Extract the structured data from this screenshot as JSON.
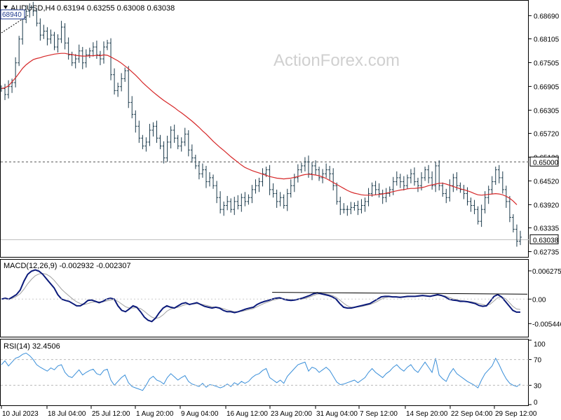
{
  "header": {
    "symbol": "AUDUSD,H4",
    "ohlc": "0.63194 0.63255 0.63008 0.63038"
  },
  "watermark": "ActionForex.com",
  "colors": {
    "price": "#1b3a4b",
    "ma": "#d62728",
    "macd": "#0b1a7a",
    "signal": "#a0a0a0",
    "rsi": "#3a8fd9",
    "hline": "#555555"
  },
  "chart_data": [
    {
      "type": "line",
      "title": "AUDUSD,H4",
      "x_ticks": [
        "10 Jul 2023",
        "18 Jul 04:00",
        "25 Jul 12:00",
        "1 Aug 20:00",
        "9 Aug 04:00",
        "16 Aug 12:00",
        "23 Aug 20:00",
        "31 Aug 04:00",
        "7 Sep 12:00",
        "14 Sep 20:00",
        "22 Sep 04:00",
        "29 Sep 12:00"
      ],
      "y_ticks": [
        "0.68690",
        "0.68105",
        "0.67505",
        "0.66905",
        "0.66305",
        "0.65720",
        "0.65120",
        "0.64520",
        "0.63920",
        "0.63335",
        "0.62735"
      ],
      "ylim": [
        0.6262,
        0.6905
      ],
      "labels": {
        "start_level": "68940",
        "level": "0.65000",
        "last": "0.63038"
      },
      "series": [
        {
          "values": [
            0.6685,
            0.667,
            0.669,
            0.67,
            0.675,
            0.681,
            0.686,
            0.688,
            0.689,
            0.688,
            0.685,
            0.682,
            0.683,
            0.681,
            0.682,
            0.679,
            0.681,
            0.684,
            0.68,
            0.677,
            0.675,
            0.676,
            0.678,
            0.675,
            0.677,
            0.678,
            0.679,
            0.677,
            0.676,
            0.679,
            0.68,
            0.672,
            0.668,
            0.669,
            0.671,
            0.673,
            0.665,
            0.662,
            0.659,
            0.656,
            0.654,
            0.655,
            0.658,
            0.659,
            0.656,
            0.654,
            0.651,
            0.655,
            0.658,
            0.656,
            0.654,
            0.655,
            0.657,
            0.653,
            0.651,
            0.649,
            0.647,
            0.648,
            0.645,
            0.646,
            0.644,
            0.641,
            0.638,
            0.639,
            0.64,
            0.638,
            0.64,
            0.639,
            0.641,
            0.64,
            0.641,
            0.643,
            0.644,
            0.645,
            0.647,
            0.648,
            0.643,
            0.642,
            0.64,
            0.641,
            0.639,
            0.642,
            0.644,
            0.646,
            0.648,
            0.649,
            0.65,
            0.647,
            0.649,
            0.648,
            0.646,
            0.647,
            0.648,
            0.647,
            0.644,
            0.64,
            0.638,
            0.638,
            0.638,
            0.6385,
            0.639,
            0.638,
            0.639,
            0.64,
            0.642,
            0.644,
            0.643,
            0.642,
            0.641,
            0.642,
            0.643,
            0.645,
            0.646,
            0.645,
            0.644,
            0.646,
            0.647,
            0.645,
            0.644,
            0.646,
            0.648,
            0.646,
            0.644,
            0.649,
            0.644,
            0.642,
            0.641,
            0.644,
            0.646,
            0.644,
            0.643,
            0.642,
            0.64,
            0.639,
            0.638,
            0.635,
            0.638,
            0.641,
            0.643,
            0.645,
            0.648,
            0.646,
            0.643,
            0.64,
            0.636,
            0.633,
            0.63,
            0.631
          ]
        },
        {
          "values": [
            0.6685,
            0.6687,
            0.6692,
            0.6702,
            0.6712,
            0.6724,
            0.6736,
            0.6745,
            0.6752,
            0.6758,
            0.6761,
            0.6763,
            0.6766,
            0.6768,
            0.677,
            0.6772,
            0.6773,
            0.6774,
            0.6774,
            0.6772,
            0.6771,
            0.6769,
            0.6768,
            0.6767,
            0.6767,
            0.6768,
            0.6768,
            0.6769,
            0.6768,
            0.677,
            0.6769,
            0.6765,
            0.676,
            0.6755,
            0.6749,
            0.6742,
            0.6735,
            0.6727,
            0.6719,
            0.671,
            0.67,
            0.6692,
            0.6684,
            0.6676,
            0.6669,
            0.6662,
            0.6655,
            0.6649,
            0.6643,
            0.6637,
            0.663,
            0.6624,
            0.6617,
            0.661,
            0.6603,
            0.6595,
            0.6587,
            0.6578,
            0.657,
            0.6561,
            0.6552,
            0.6544,
            0.6536,
            0.6529,
            0.6521,
            0.6513,
            0.6506,
            0.6499,
            0.6492,
            0.6486,
            0.6482,
            0.6478,
            0.6475,
            0.6472,
            0.6469,
            0.6466,
            0.6463,
            0.6461,
            0.6459,
            0.6458,
            0.6457,
            0.6458,
            0.6459,
            0.6461,
            0.6463,
            0.6466,
            0.6468,
            0.6469,
            0.6468,
            0.6467,
            0.6465,
            0.6462,
            0.6458,
            0.6453,
            0.6448,
            0.6443,
            0.6438,
            0.6433,
            0.6428,
            0.6424,
            0.6421,
            0.6419,
            0.6417,
            0.6416,
            0.6416,
            0.6416,
            0.6417,
            0.6418,
            0.6419,
            0.6421,
            0.6423,
            0.6425,
            0.6427,
            0.6429,
            0.643,
            0.6432,
            0.6433,
            0.6433,
            0.6434,
            0.6435,
            0.6437,
            0.644,
            0.6442,
            0.6444,
            0.6446,
            0.6446,
            0.6444,
            0.6441,
            0.6438,
            0.6435,
            0.6432,
            0.643,
            0.6427,
            0.6424,
            0.642,
            0.6417,
            0.6416,
            0.6417,
            0.6418,
            0.6419,
            0.642,
            0.6419,
            0.6417,
            0.6413,
            0.6408,
            0.6401,
            0.6392
          ]
        }
      ]
    },
    {
      "type": "line",
      "title": "MACD(12,26,9) -0.002932 -0.002307",
      "y_ticks": [
        "0.006275",
        "0.00",
        "-0.005446"
      ],
      "ylim": [
        -0.0082,
        0.0086
      ],
      "series": [
        {
          "values": [
            0.0,
            0.0002,
            0.0,
            0.0005,
            0.001,
            0.002,
            0.004,
            0.0055,
            0.0062,
            0.0065,
            0.0062,
            0.0055,
            0.0045,
            0.0035,
            0.0025,
            0.001,
            0.0,
            -0.0003,
            -0.0005,
            -0.001,
            -0.0015,
            -0.0015,
            -0.001,
            -0.0003,
            -0.0002,
            -0.0005,
            -0.0008,
            -0.0005,
            0.0,
            0.0002,
            0.0,
            -0.0015,
            -0.0025,
            -0.0028,
            -0.0022,
            -0.0015,
            -0.0018,
            -0.0028,
            -0.004,
            -0.0047,
            -0.005,
            -0.0042,
            -0.003,
            -0.002,
            -0.0015,
            -0.0018,
            -0.002,
            -0.0015,
            -0.001,
            -0.0008,
            -0.0012,
            -0.001,
            -0.0008,
            -0.0012,
            -0.0016,
            -0.0018,
            -0.002,
            -0.0018,
            -0.002,
            -0.0025,
            -0.0028,
            -0.0028,
            -0.003,
            -0.0028,
            -0.0025,
            -0.0022,
            -0.002,
            -0.0018,
            -0.0012,
            -0.0008,
            -0.0005,
            -0.0003,
            0.0,
            0.0002,
            0.0003,
            0.0,
            -0.0002,
            -0.0003,
            -0.0002,
            0.0,
            0.0002,
            0.0005,
            0.0008,
            0.0012,
            0.0014,
            0.0012,
            0.001,
            0.0008,
            0.0005,
            0.0,
            -0.001,
            -0.0018,
            -0.002,
            -0.002,
            -0.0018,
            -0.0016,
            -0.0014,
            -0.0012,
            -0.001,
            -0.0005,
            0.0,
            0.0005,
            0.0006,
            0.0006,
            0.0005,
            0.0005,
            0.0004,
            0.0005,
            0.0006,
            0.0006,
            0.0006,
            0.0007,
            0.0008,
            0.0007,
            0.0006,
            0.0008,
            0.001,
            0.0008,
            0.0005,
            0.0,
            -0.0002,
            -0.0003,
            -0.0005,
            -0.0005,
            -0.0006,
            -0.0008,
            -0.001,
            -0.0014,
            -0.0016,
            -0.0015,
            -0.0005,
            0.0006,
            0.001,
            0.0005,
            -0.0005,
            -0.0015,
            -0.0025,
            -0.0029,
            -0.0029
          ]
        },
        {
          "values": [
            0.0,
            0.0001,
            0.0,
            0.0002,
            0.0006,
            0.0012,
            0.0022,
            0.0034,
            0.0044,
            0.0052,
            0.0056,
            0.0057,
            0.0055,
            0.005,
            0.0042,
            0.0032,
            0.0022,
            0.0014,
            0.0007,
            0.0,
            -0.0006,
            -0.001,
            -0.0012,
            -0.001,
            -0.0007,
            -0.0006,
            -0.0006,
            -0.0006,
            -0.0004,
            -0.0002,
            -0.0001,
            -0.0005,
            -0.0011,
            -0.0017,
            -0.002,
            -0.002,
            -0.0019,
            -0.0021,
            -0.0027,
            -0.0034,
            -0.004,
            -0.0043,
            -0.0041,
            -0.0035,
            -0.0027,
            -0.0022,
            -0.002,
            -0.0018,
            -0.0015,
            -0.0012,
            -0.0011,
            -0.0011,
            -0.001,
            -0.0011,
            -0.0013,
            -0.0015,
            -0.0017,
            -0.0018,
            -0.0019,
            -0.0021,
            -0.0024,
            -0.0026,
            -0.0028,
            -0.0028,
            -0.0027,
            -0.0025,
            -0.0023,
            -0.0021,
            -0.0017,
            -0.0013,
            -0.0009,
            -0.0006,
            -0.0003,
            -0.0001,
            0.0001,
            0.0001,
            0.0,
            -0.0001,
            -0.0002,
            -0.0001,
            0.0,
            0.0002,
            0.0005,
            0.0008,
            0.0011,
            0.0012,
            0.0012,
            0.001,
            0.0008,
            0.0004,
            -0.0002,
            -0.0009,
            -0.0015,
            -0.0018,
            -0.0018,
            -0.0017,
            -0.0016,
            -0.0014,
            -0.0012,
            -0.0009,
            -0.0005,
            0.0,
            0.0003,
            0.0005,
            0.0005,
            0.0005,
            0.0005,
            0.0005,
            0.0005,
            0.0006,
            0.0006,
            0.0006,
            0.0007,
            0.0007,
            0.0007,
            0.0007,
            0.0008,
            0.0008,
            0.0007,
            0.0004,
            0.0001,
            -0.0001,
            -0.0003,
            -0.0004,
            -0.0005,
            -0.0006,
            -0.0008,
            -0.001,
            -0.0012,
            -0.0014,
            -0.0011,
            -0.0004,
            0.0003,
            0.0005,
            0.0001,
            -0.0007,
            -0.0016,
            -0.0022,
            -0.0023
          ]
        }
      ]
    },
    {
      "type": "line",
      "title": "RSI(14) 32.4506",
      "y_ticks": [
        "100",
        "70",
        "30",
        "0"
      ],
      "ylim": [
        0,
        100
      ],
      "series": [
        {
          "values": [
            62,
            68,
            60,
            66,
            72,
            74,
            78,
            80,
            76,
            70,
            62,
            58,
            55,
            52,
            57,
            54,
            60,
            62,
            50,
            44,
            42,
            48,
            54,
            46,
            50,
            53,
            55,
            48,
            46,
            53,
            55,
            38,
            30,
            36,
            42,
            46,
            34,
            28,
            26,
            24,
            22,
            30,
            40,
            44,
            38,
            36,
            32,
            42,
            48,
            43,
            38,
            42,
            45,
            36,
            32,
            30,
            28,
            33,
            27,
            31,
            30,
            28,
            26,
            28,
            32,
            28,
            34,
            31,
            36,
            33,
            36,
            42,
            46,
            48,
            53,
            56,
            42,
            38,
            34,
            38,
            33,
            44,
            50,
            56,
            62,
            64,
            66,
            52,
            58,
            56,
            50,
            54,
            58,
            53,
            44,
            35,
            31,
            32,
            34,
            36,
            38,
            34,
            38,
            42,
            50,
            56,
            50,
            46,
            42,
            48,
            52,
            58,
            62,
            56,
            52,
            58,
            62,
            54,
            50,
            58,
            66,
            58,
            50,
            72,
            46,
            40,
            36,
            48,
            56,
            48,
            44,
            40,
            36,
            33,
            30,
            26,
            38,
            48,
            54,
            60,
            72,
            62,
            50,
            40,
            33,
            30,
            28,
            32
          ]
        }
      ]
    }
  ]
}
